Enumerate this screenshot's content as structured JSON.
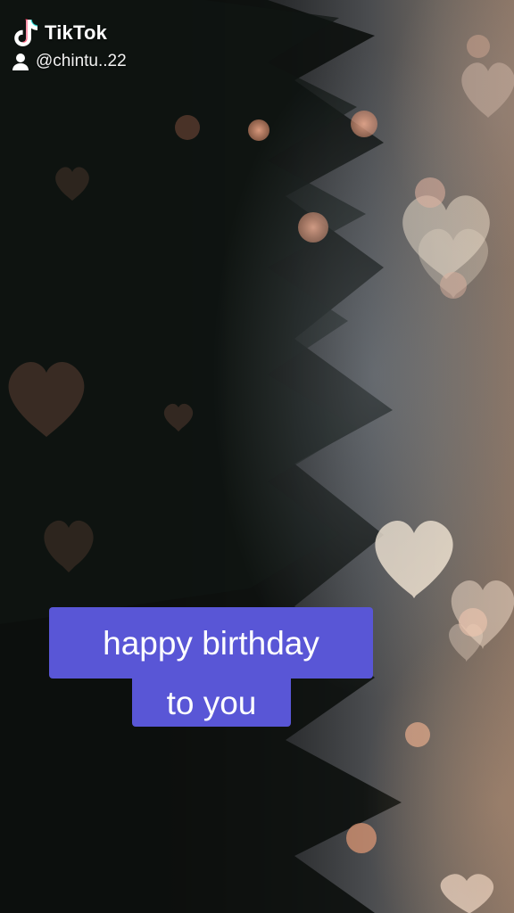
{
  "brand": {
    "name": "TikTok",
    "icon": "tiktok-note-icon"
  },
  "user": {
    "handle": "@chintu..22",
    "icon": "user-icon"
  },
  "caption": {
    "line1": "happy birthday",
    "line2": "to you",
    "background_color": "#5956d6"
  },
  "colors": {
    "heart": "#f1ddc8",
    "bokeh": "#e6a07d"
  }
}
